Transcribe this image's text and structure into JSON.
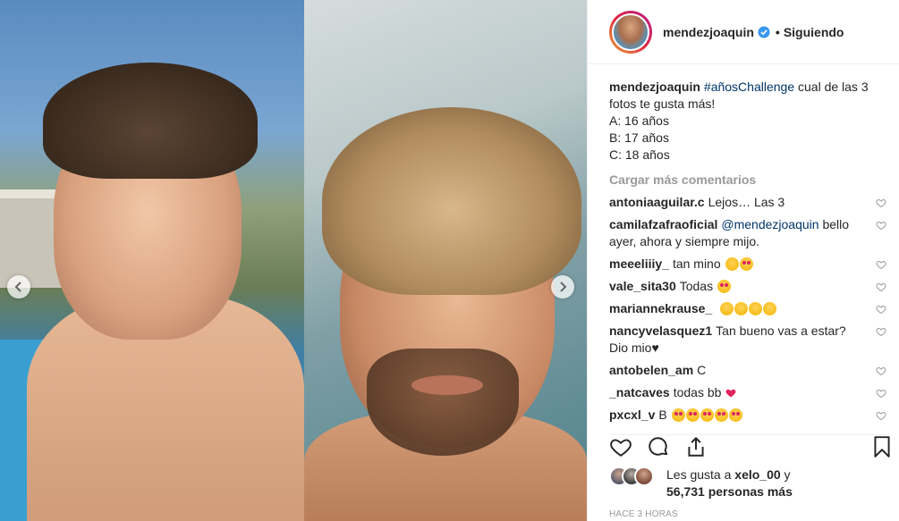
{
  "post": {
    "username": "mendezjoaquin",
    "follow_status": "Siguiendo",
    "separator": "•",
    "caption": {
      "username": "mendezjoaquin",
      "hashtag": "#añosChallenge",
      "text": "cual de las 3 fotos te gusta más!",
      "lines": [
        "A: 16 años",
        "B: 17 años",
        "C: 18 años"
      ]
    },
    "load_more": "Cargar más comentarios",
    "comments": [
      {
        "user": "antoniaaguilar.c",
        "text": "Lejos… Las 3"
      },
      {
        "user": "camilafzafraoficial",
        "mention": "@mendezjoaquin",
        "text": "bello ayer, ahora y siempre mijo."
      },
      {
        "user": "meeeliiiy_",
        "text": "tan mino"
      },
      {
        "user": "vale_sita30",
        "text": "Todas"
      },
      {
        "user": "mariannekrause_",
        "text": ""
      },
      {
        "user": "nancyvelasquez1",
        "text": "Tan bueno vas a estar? Dio mio♥"
      },
      {
        "user": "antobelen_am",
        "text": "C"
      },
      {
        "user": "_natcaves",
        "text": "todas bb"
      },
      {
        "user": "pxcxl_v",
        "text": "B"
      }
    ],
    "likes": {
      "prefix": "Les gusta a",
      "user": "xelo_00",
      "connector": "y",
      "count": "56,731",
      "suffix": "personas más"
    },
    "time_ago": "HACE 3 HORAS"
  },
  "icons": {
    "verified": "verified-badge-icon",
    "like": "heart-outline-icon",
    "comment": "comment-bubble-icon",
    "share": "share-upload-icon",
    "save": "bookmark-icon"
  },
  "colors": {
    "text": "#262626",
    "muted": "#999999",
    "link": "#003569",
    "verified": "#3897f0",
    "red_heart": "#e0245e"
  }
}
